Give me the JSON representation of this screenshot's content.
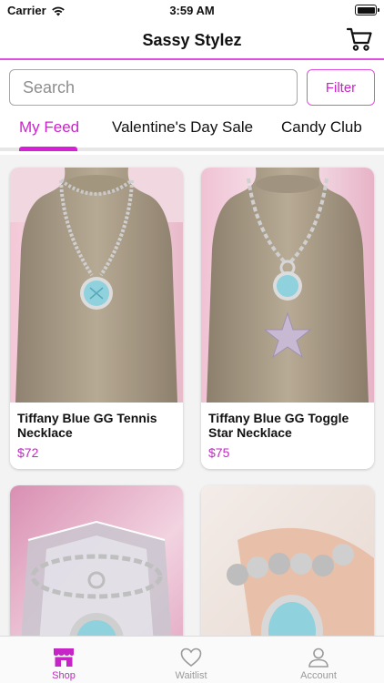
{
  "status_bar": {
    "carrier": "Carrier",
    "time": "3:59 AM"
  },
  "header": {
    "title": "Sassy Stylez",
    "cart_icon": "cart-icon"
  },
  "search": {
    "placeholder": "Search",
    "value": ""
  },
  "filter": {
    "label": "Filter"
  },
  "tabs": [
    {
      "label": "My Feed",
      "active": true
    },
    {
      "label": "Valentine's Day Sale",
      "active": false
    },
    {
      "label": "Candy Club",
      "active": false
    }
  ],
  "products": [
    {
      "name": "Tiffany Blue GG Tennis Necklace",
      "price": "$72"
    },
    {
      "name": "Tiffany Blue GG Toggle Star Necklace",
      "price": "$75"
    },
    {
      "name": "",
      "price": ""
    },
    {
      "name": "",
      "price": ""
    }
  ],
  "tabbar": {
    "items": [
      {
        "label": "Shop",
        "icon": "shop-icon",
        "active": true
      },
      {
        "label": "Waitlist",
        "icon": "heart-icon",
        "active": false
      },
      {
        "label": "Account",
        "icon": "account-icon",
        "active": false
      }
    ]
  },
  "colors": {
    "accent": "#d61fd6",
    "price": "#c22ac2",
    "border": "#e14fe1"
  }
}
